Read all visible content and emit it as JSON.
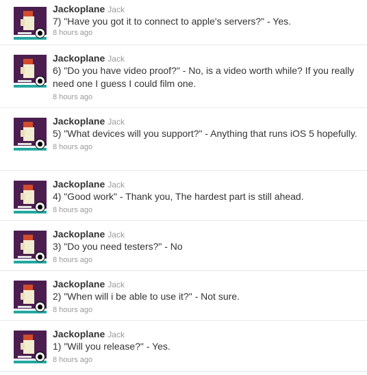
{
  "tweets": [
    {
      "username": "Jackoplane",
      "screen_name": "Jack",
      "text": "7) \"Have you got it to connect to apple's servers?\" - Yes.",
      "timestamp": "8 hours ago"
    },
    {
      "username": "Jackoplane",
      "screen_name": "Jack",
      "text": "6) \"Do you have video proof?\" - No, is a video worth while? If you really need one I guess I could film one.",
      "timestamp": "8 hours ago"
    },
    {
      "username": "Jackoplane",
      "screen_name": "Jack",
      "text": "5) \"What devices will you support?\" - Anything that runs iOS 5 hopefully.",
      "timestamp": "8 hours ago"
    },
    {
      "username": "Jackoplane",
      "screen_name": "Jack",
      "text": "4) \"Good work\" - Thank you, The hardest part is still ahead.",
      "timestamp": "8 hours ago"
    },
    {
      "username": "Jackoplane",
      "screen_name": "Jack",
      "text": "3) \"Do you need testers?\" - No",
      "timestamp": "8 hours ago"
    },
    {
      "username": "Jackoplane",
      "screen_name": "Jack",
      "text": "2) \"When will i be able to use it?\" - Not sure.",
      "timestamp": "8 hours ago"
    },
    {
      "username": "Jackoplane",
      "screen_name": "Jack",
      "text": "1) \"Will you release?\" - Yes.",
      "timestamp": "8 hours ago"
    }
  ],
  "colors": {
    "avatar_bg": "#4b1e4f",
    "avatar_accent": "#22a7a0",
    "username": "#333333",
    "meta": "#999999",
    "divider": "#e8e8e8"
  },
  "icons": {
    "avatar": "pixel-art-avatar",
    "badge": "apple-logo-icon"
  }
}
